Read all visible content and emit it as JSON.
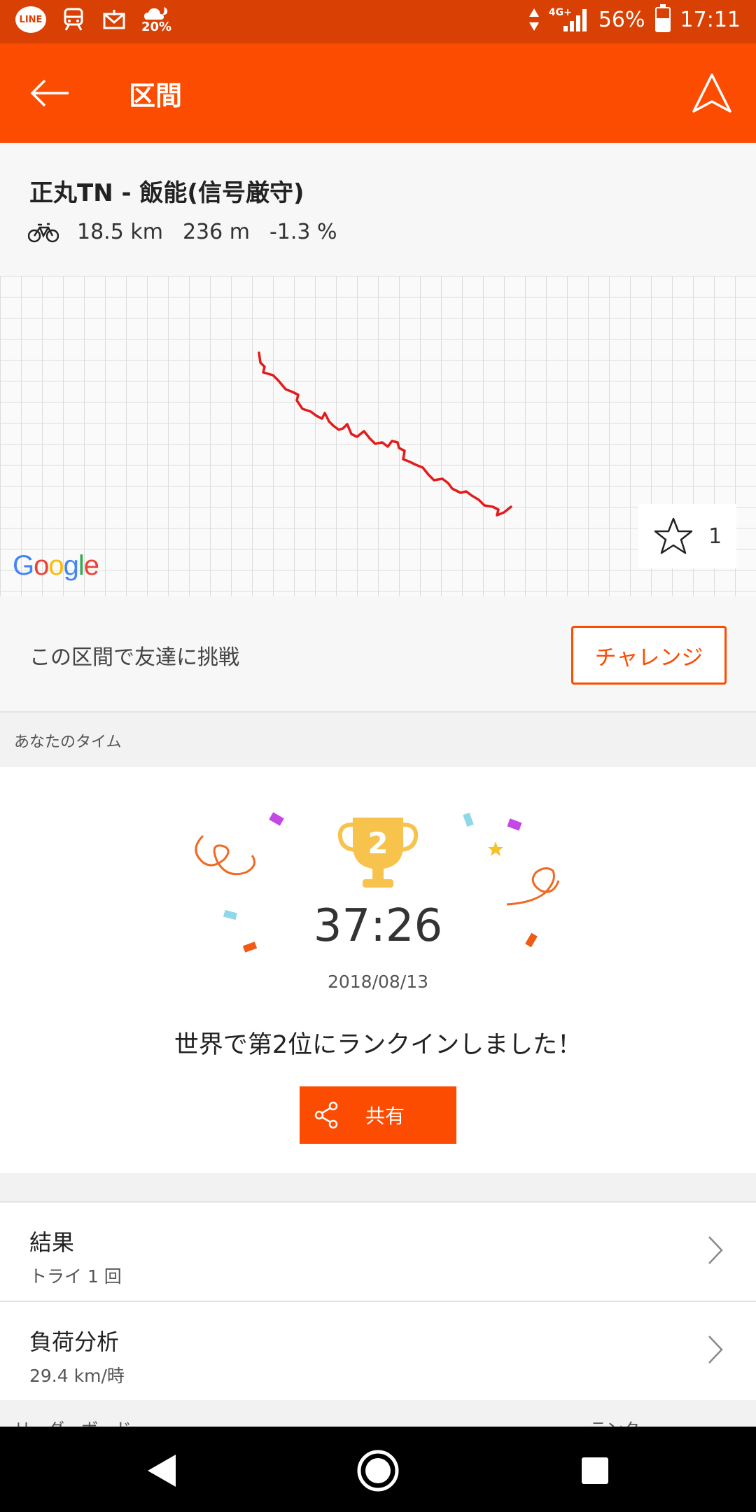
{
  "status_bar": {
    "line_label": "LINE",
    "weather_percent": "20%",
    "network": "4G+",
    "battery_percent": "56%",
    "battery_level": 0.56,
    "time": "17:11"
  },
  "app_bar": {
    "title": "区間"
  },
  "segment": {
    "name": "正丸TN - 飯能(信号厳守)",
    "distance": "18.5 km",
    "elevation": "236 m",
    "grade": "-1.3 %"
  },
  "map": {
    "logo_text": "Google",
    "star_count": "1",
    "route_color": "#e31b1b"
  },
  "challenge": {
    "text": "この区間で友達に挑戦",
    "button_label": "チャレンジ"
  },
  "your_time": {
    "section_label": "あなたのタイム",
    "rank_number": "2",
    "time": "37:26",
    "date": "2018/08/13",
    "message": "世界で第2位にランクインしました！",
    "share_label": "共有"
  },
  "rows": {
    "results_title": "結果",
    "results_sub": "トライ 1 回",
    "load_title": "負荷分析",
    "load_sub": "29.4 km/時"
  },
  "bottom_peek": {
    "left": "リーダーボード",
    "right": "ランク"
  },
  "colors": {
    "brand_orange": "#fc4c02",
    "status_bar": "#d84004",
    "trophy_gold": "#f7c34c"
  }
}
